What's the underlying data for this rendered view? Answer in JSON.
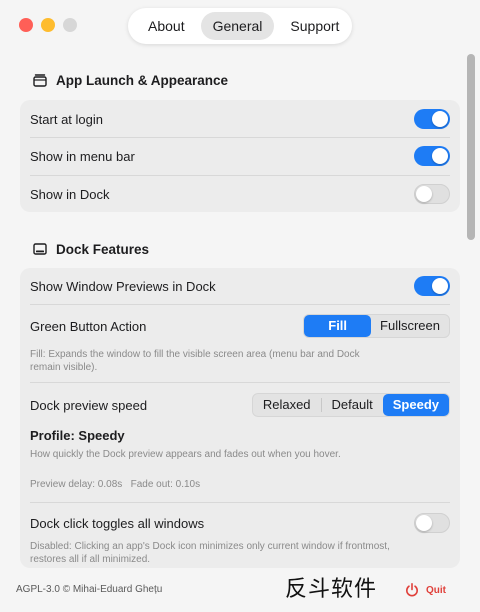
{
  "tabs": [
    {
      "label": "About"
    },
    {
      "label": "General"
    },
    {
      "label": "Support"
    }
  ],
  "sections": {
    "launch": {
      "title": "App Launch & Appearance",
      "rows": [
        {
          "label": "Start at login",
          "state": "on"
        },
        {
          "label": "Show in menu bar",
          "state": "on"
        },
        {
          "label": "Show in Dock",
          "state": "off"
        }
      ]
    },
    "dock": {
      "title": "Dock Features",
      "show_previews_label": "Show Window Previews in Dock",
      "green_button": {
        "label": "Green Button Action",
        "options": [
          "Fill",
          "Fullscreen"
        ],
        "selected": "Fill",
        "desc": "Fill: Expands the window to fill the visible screen area (menu bar and Dock remain visible)."
      },
      "preview_speed": {
        "label": "Dock preview speed",
        "options": [
          "Relaxed",
          "Default",
          "Speedy"
        ],
        "selected": "Speedy",
        "profile": "Profile: Speedy",
        "desc": "How quickly the Dock preview appears and fades out when you hover.",
        "timing": "Preview delay: 0.08s   Fade out: 0.10s"
      },
      "click_toggles": {
        "label": "Dock click toggles all windows",
        "state": "off",
        "desc": "Disabled: Clicking an app's Dock icon minimizes only current window if frontmost, restores all if all minimized."
      }
    }
  },
  "footer": {
    "license": "AGPL-3.0 © Mihai-Eduard Ghețu",
    "watermark": "反斗软件",
    "quit_label": "Quit"
  },
  "colors": {
    "accent": "#1e7cf5",
    "quit": "#e0403a"
  }
}
